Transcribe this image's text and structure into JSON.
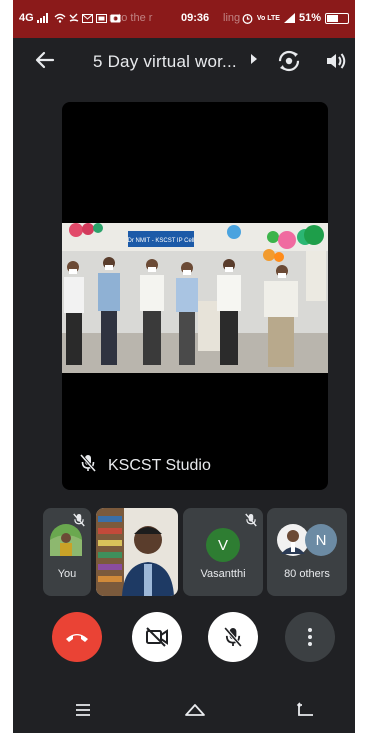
{
  "status_bar": {
    "network": "4G",
    "ticker_text": "n to the r",
    "time": "09:36",
    "ticker_text_2": "ling interfa",
    "volte": "Vo LTE",
    "battery": "51%"
  },
  "top_bar": {
    "title": "5 Day virtual wor...",
    "icons": [
      "back-arrow-icon",
      "caret-right-icon",
      "switch-camera-icon",
      "speaker-icon"
    ]
  },
  "main_tile": {
    "name": "KSCST Studio",
    "banner_text": "Dr NMIT - KSCST IP Cell",
    "mic_muted": true
  },
  "participants": [
    {
      "label": "You",
      "mic_muted": true
    },
    {
      "label": "",
      "mic_muted": false
    },
    {
      "label": "Vasantthi",
      "initial": "V",
      "avatar_color": "#2e7d32",
      "mic_muted": true
    },
    {
      "label": "80 others",
      "initial": "N",
      "avatar_color": "#6c8ba4"
    }
  ],
  "controls": {
    "end_call_color": "#ea4335",
    "buttons": [
      "end-call",
      "camera-off",
      "mic-off",
      "more-options"
    ]
  },
  "nav_bar": [
    "menu",
    "home",
    "back"
  ]
}
